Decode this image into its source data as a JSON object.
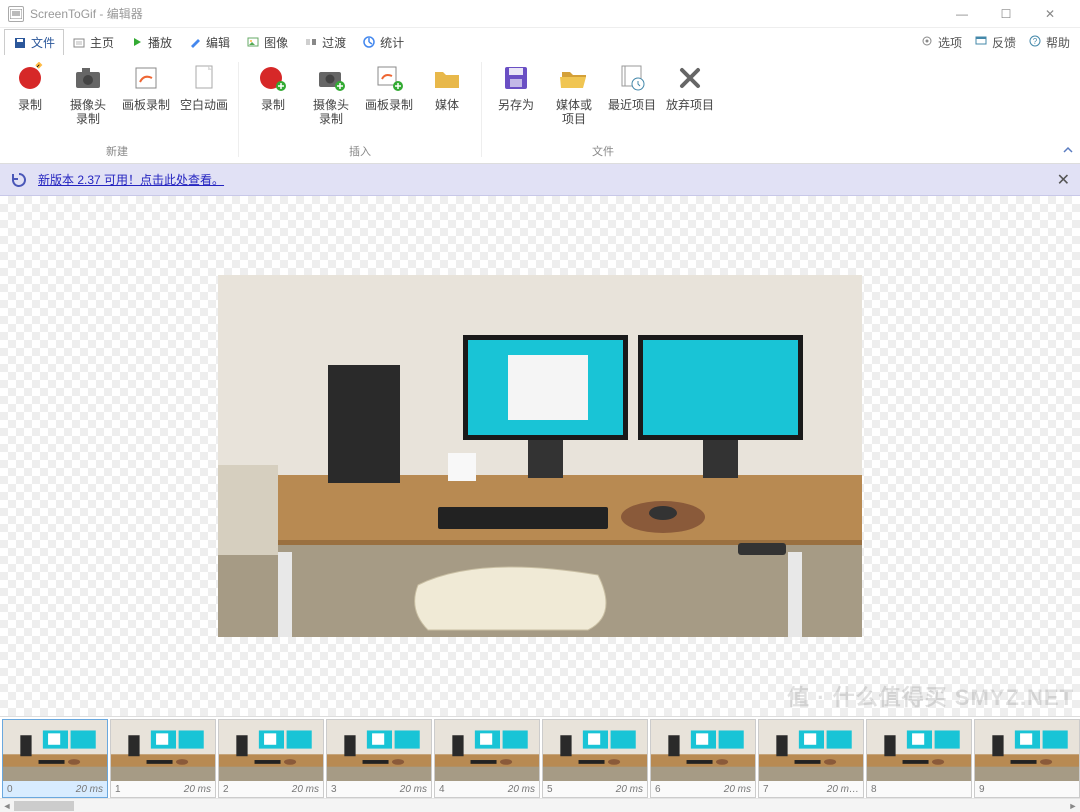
{
  "window": {
    "app": "ScreenToGif",
    "subtitle": "编辑器"
  },
  "winbuttons": {
    "min": "—",
    "max": "☐",
    "close": "✕"
  },
  "tabs": [
    {
      "id": "file",
      "label": "文件",
      "active": true
    },
    {
      "id": "home",
      "label": "主页"
    },
    {
      "id": "play",
      "label": "播放"
    },
    {
      "id": "edit",
      "label": "编辑"
    },
    {
      "id": "image",
      "label": "图像"
    },
    {
      "id": "transition",
      "label": "过渡"
    },
    {
      "id": "stats",
      "label": "统计"
    }
  ],
  "toplinks": [
    {
      "id": "options",
      "label": "选项"
    },
    {
      "id": "feedback",
      "label": "反馈"
    },
    {
      "id": "help",
      "label": "帮助"
    }
  ],
  "ribbon": {
    "groups": [
      {
        "label": "新建",
        "items": [
          {
            "id": "record",
            "label": "录制",
            "icon": "record-red"
          },
          {
            "id": "webcam",
            "label": "摄像头录制",
            "icon": "camera"
          },
          {
            "id": "board",
            "label": "画板录制",
            "icon": "board"
          },
          {
            "id": "blank",
            "label": "空白动画",
            "icon": "blank"
          }
        ]
      },
      {
        "label": "插入",
        "items": [
          {
            "id": "record2",
            "label": "录制",
            "icon": "record-red-plus"
          },
          {
            "id": "webcam2",
            "label": "摄像头录制",
            "icon": "camera-plus"
          },
          {
            "id": "board2",
            "label": "画板录制",
            "icon": "board-plus"
          },
          {
            "id": "media",
            "label": "媒体",
            "icon": "folder"
          }
        ]
      },
      {
        "label": "文件",
        "items": [
          {
            "id": "saveas",
            "label": "另存为",
            "icon": "save"
          },
          {
            "id": "mediaproj",
            "label": "媒体或项目",
            "icon": "folder-open"
          },
          {
            "id": "recent",
            "label": "最近项目",
            "icon": "recent"
          },
          {
            "id": "discard",
            "label": "放弃项目",
            "icon": "discard"
          }
        ]
      }
    ]
  },
  "notification": {
    "text": "新版本 2.37 可用！点击此处查看。",
    "close": "✕"
  },
  "frames": [
    {
      "index": 0,
      "duration": "20 ms",
      "selected": true
    },
    {
      "index": 1,
      "duration": "20 ms"
    },
    {
      "index": 2,
      "duration": "20 ms"
    },
    {
      "index": 3,
      "duration": "20 ms"
    },
    {
      "index": 4,
      "duration": "20 ms"
    },
    {
      "index": 5,
      "duration": "20 ms"
    },
    {
      "index": 6,
      "duration": "20 ms"
    },
    {
      "index": 7,
      "duration": "20 m…"
    },
    {
      "index": 8,
      "duration": ""
    },
    {
      "index": 9,
      "duration": ""
    }
  ],
  "watermark": "值 · 什么值得买 SMYZ.NET"
}
